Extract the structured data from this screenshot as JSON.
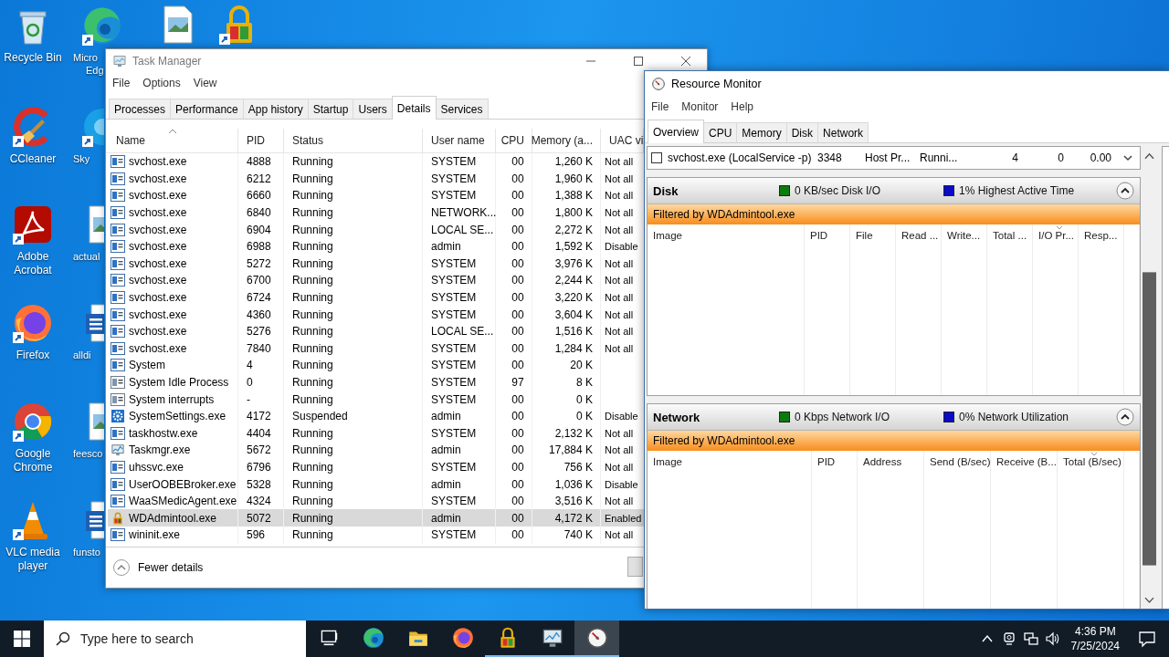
{
  "desktop_icons": [
    {
      "kind": "recycle",
      "label": "Recycle Bin",
      "shortcut": false
    },
    {
      "kind": "edge",
      "label_lines": [
        "Micro",
        "Edg"
      ],
      "shortcut": true
    },
    {
      "kind": "image-file",
      "shortcut": false
    },
    {
      "kind": "lock-app",
      "shortcut": true
    },
    {
      "kind": "ccleaner",
      "label": "CCleaner",
      "shortcut": true
    },
    {
      "kind": "skype",
      "label": "Sky",
      "shortcut": true
    },
    {
      "kind": "acrobat",
      "label": "Adobe Acrobat",
      "shortcut": true
    },
    {
      "kind": "image-file",
      "label": "actual",
      "shortcut": false
    },
    {
      "kind": "firefox",
      "label": "Firefox",
      "shortcut": true
    },
    {
      "kind": "word-doc",
      "label": "alldi",
      "shortcut": false
    },
    {
      "kind": "chrome",
      "label": "Google Chrome",
      "shortcut": true
    },
    {
      "kind": "image-file",
      "label": "feesco",
      "shortcut": false
    },
    {
      "kind": "vlc",
      "label": "VLC media player",
      "shortcut": true
    },
    {
      "kind": "word-doc",
      "label": "funsto",
      "shortcut": false
    }
  ],
  "task_manager": {
    "title": "Task Manager",
    "menu": [
      "File",
      "Options",
      "View"
    ],
    "tabs": [
      {
        "label": "Processes",
        "selected": false
      },
      {
        "label": "Performance",
        "selected": false
      },
      {
        "label": "App history",
        "selected": false
      },
      {
        "label": "Startup",
        "selected": false
      },
      {
        "label": "Users",
        "selected": false
      },
      {
        "label": "Details",
        "selected": true
      },
      {
        "label": "Services",
        "selected": false
      }
    ],
    "columns": [
      {
        "label": "Name",
        "sorted": true
      },
      {
        "label": "PID",
        "sorted": false
      },
      {
        "label": "Status",
        "sorted": false
      },
      {
        "label": "User name",
        "sorted": false
      },
      {
        "label": "CPU",
        "sorted": false
      },
      {
        "label": "Memory (a...",
        "sorted": false
      },
      {
        "label": "UAC vi",
        "sorted": false
      }
    ],
    "rows": [
      {
        "kind": "app",
        "name": "svchost.exe",
        "pid": "4888",
        "status": "Running",
        "user": "SYSTEM",
        "cpu": "00",
        "memory": "1,260 K",
        "uac": "Not all",
        "selected": false
      },
      {
        "kind": "app",
        "name": "svchost.exe",
        "pid": "6212",
        "status": "Running",
        "user": "SYSTEM",
        "cpu": "00",
        "memory": "1,960 K",
        "uac": "Not all",
        "selected": false
      },
      {
        "kind": "app",
        "name": "svchost.exe",
        "pid": "6660",
        "status": "Running",
        "user": "SYSTEM",
        "cpu": "00",
        "memory": "1,388 K",
        "uac": "Not all",
        "selected": false
      },
      {
        "kind": "app",
        "name": "svchost.exe",
        "pid": "6840",
        "status": "Running",
        "user": "NETWORK...",
        "cpu": "00",
        "memory": "1,800 K",
        "uac": "Not all",
        "selected": false
      },
      {
        "kind": "app",
        "name": "svchost.exe",
        "pid": "6904",
        "status": "Running",
        "user": "LOCAL SE...",
        "cpu": "00",
        "memory": "2,272 K",
        "uac": "Not all",
        "selected": false
      },
      {
        "kind": "app",
        "name": "svchost.exe",
        "pid": "6988",
        "status": "Running",
        "user": "admin",
        "cpu": "00",
        "memory": "1,592 K",
        "uac": "Disable",
        "selected": false
      },
      {
        "kind": "app",
        "name": "svchost.exe",
        "pid": "5272",
        "status": "Running",
        "user": "SYSTEM",
        "cpu": "00",
        "memory": "3,976 K",
        "uac": "Not all",
        "selected": false
      },
      {
        "kind": "app",
        "name": "svchost.exe",
        "pid": "6700",
        "status": "Running",
        "user": "SYSTEM",
        "cpu": "00",
        "memory": "2,244 K",
        "uac": "Not all",
        "selected": false
      },
      {
        "kind": "app",
        "name": "svchost.exe",
        "pid": "6724",
        "status": "Running",
        "user": "SYSTEM",
        "cpu": "00",
        "memory": "3,220 K",
        "uac": "Not all",
        "selected": false
      },
      {
        "kind": "app",
        "name": "svchost.exe",
        "pid": "4360",
        "status": "Running",
        "user": "SYSTEM",
        "cpu": "00",
        "memory": "3,604 K",
        "uac": "Not all",
        "selected": false
      },
      {
        "kind": "app",
        "name": "svchost.exe",
        "pid": "5276",
        "status": "Running",
        "user": "LOCAL SE...",
        "cpu": "00",
        "memory": "1,516 K",
        "uac": "Not all",
        "selected": false
      },
      {
        "kind": "app",
        "name": "svchost.exe",
        "pid": "7840",
        "status": "Running",
        "user": "SYSTEM",
        "cpu": "00",
        "memory": "1,284 K",
        "uac": "Not all",
        "selected": false
      },
      {
        "kind": "app",
        "name": "System",
        "pid": "4",
        "status": "Running",
        "user": "SYSTEM",
        "cpu": "00",
        "memory": "20 K",
        "selected": false
      },
      {
        "kind": "system",
        "name": "System Idle Process",
        "pid": "0",
        "status": "Running",
        "user": "SYSTEM",
        "cpu": "97",
        "memory": "8 K",
        "selected": false
      },
      {
        "kind": "system",
        "name": "System interrupts",
        "pid": "-",
        "status": "Running",
        "user": "SYSTEM",
        "cpu": "00",
        "memory": "0 K",
        "selected": false
      },
      {
        "kind": "settings",
        "name": "SystemSettings.exe",
        "pid": "4172",
        "status": "Suspended",
        "user": "admin",
        "cpu": "00",
        "memory": "0 K",
        "uac": "Disable",
        "selected": false
      },
      {
        "kind": "app",
        "name": "taskhostw.exe",
        "pid": "4404",
        "status": "Running",
        "user": "SYSTEM",
        "cpu": "00",
        "memory": "2,132 K",
        "uac": "Not all",
        "selected": false
      },
      {
        "kind": "monitor",
        "name": "Taskmgr.exe",
        "pid": "5672",
        "status": "Running",
        "user": "admin",
        "cpu": "00",
        "memory": "17,884 K",
        "uac": "Not all",
        "selected": false
      },
      {
        "kind": "app",
        "name": "uhssvc.exe",
        "pid": "6796",
        "status": "Running",
        "user": "SYSTEM",
        "cpu": "00",
        "memory": "756 K",
        "uac": "Not all",
        "selected": false
      },
      {
        "kind": "app",
        "name": "UserOOBEBroker.exe",
        "pid": "5328",
        "status": "Running",
        "user": "admin",
        "cpu": "00",
        "memory": "1,036 K",
        "uac": "Disable",
        "selected": false
      },
      {
        "kind": "app",
        "name": "WaaSMedicAgent.exe",
        "pid": "4324",
        "status": "Running",
        "user": "SYSTEM",
        "cpu": "00",
        "memory": "3,516 K",
        "uac": "Not all",
        "selected": false
      },
      {
        "kind": "lock",
        "name": "WDAdmintool.exe",
        "pid": "5072",
        "status": "Running",
        "user": "admin",
        "cpu": "00",
        "memory": "4,172 K",
        "uac": "Enabled",
        "selected": true
      },
      {
        "kind": "app",
        "name": "wininit.exe",
        "pid": "596",
        "status": "Running",
        "user": "SYSTEM",
        "cpu": "00",
        "memory": "740 K",
        "uac": "Not all",
        "selected": false
      }
    ],
    "footer_link": "Fewer details"
  },
  "resource_monitor": {
    "title": "Resource Monitor",
    "menu": [
      "File",
      "Monitor",
      "Help"
    ],
    "tabs": [
      {
        "label": "Overview",
        "selected": true
      },
      {
        "label": "CPU",
        "selected": false
      },
      {
        "label": "Memory",
        "selected": false
      },
      {
        "label": "Disk",
        "selected": false
      },
      {
        "label": "Network",
        "selected": false
      }
    ],
    "process_row": {
      "checked": false,
      "image": "svchost.exe (LocalService -p)",
      "pid": "3348",
      "description": "Host Pr...",
      "status": "Runni...",
      "column_5": "4",
      "column_6": "0",
      "column_7": "0.00"
    },
    "sections": [
      {
        "title": "Disk",
        "expanded": true,
        "legend": [
          {
            "color": "#0c7a0c",
            "text": "0 KB/sec Disk I/O"
          },
          {
            "color": "#0a0ac8",
            "text": "1% Highest Active Time"
          }
        ],
        "filter": "Filtered by WDAdmintool.exe",
        "columns": [
          {
            "label": "Image",
            "sorted": false
          },
          {
            "label": "PID",
            "sorted": false
          },
          {
            "label": "File",
            "sorted": false
          },
          {
            "label": "Read ...",
            "sorted": false
          },
          {
            "label": "Write...",
            "sorted": false
          },
          {
            "label": "Total ...",
            "sorted": false
          },
          {
            "label": "I/O Pr...",
            "sorted": true
          },
          {
            "label": "Resp...",
            "sorted": false
          }
        ]
      },
      {
        "title": "Network",
        "expanded": true,
        "legend": [
          {
            "color": "#0c7a0c",
            "text": "0 Kbps Network I/O"
          },
          {
            "color": "#0a0ac8",
            "text": "0% Network Utilization"
          }
        ],
        "filter": "Filtered by WDAdmintool.exe",
        "columns": [
          {
            "label": "Image",
            "sorted": false
          },
          {
            "label": "PID",
            "sorted": false
          },
          {
            "label": "Address",
            "sorted": false
          },
          {
            "label": "Send (B/sec)",
            "sorted": false
          },
          {
            "label": "Receive (B...",
            "sorted": false
          },
          {
            "label": "Total (B/sec)",
            "sorted": true
          }
        ]
      }
    ]
  },
  "taskbar": {
    "search": {
      "placeholder": "Type here to search"
    },
    "apps": [
      {
        "kind": "task-view",
        "running": false,
        "selected": false
      },
      {
        "kind": "edge",
        "running": false,
        "selected": false
      },
      {
        "kind": "explorer",
        "running": false,
        "selected": false
      },
      {
        "kind": "firefox",
        "running": false,
        "selected": false
      },
      {
        "kind": "lock-app",
        "running": true,
        "selected": false
      },
      {
        "kind": "monitor",
        "running": true,
        "selected": false
      },
      {
        "kind": "resmon",
        "running": true,
        "selected": true
      }
    ],
    "time": "4:36 PM",
    "date": "7/25/2024"
  }
}
